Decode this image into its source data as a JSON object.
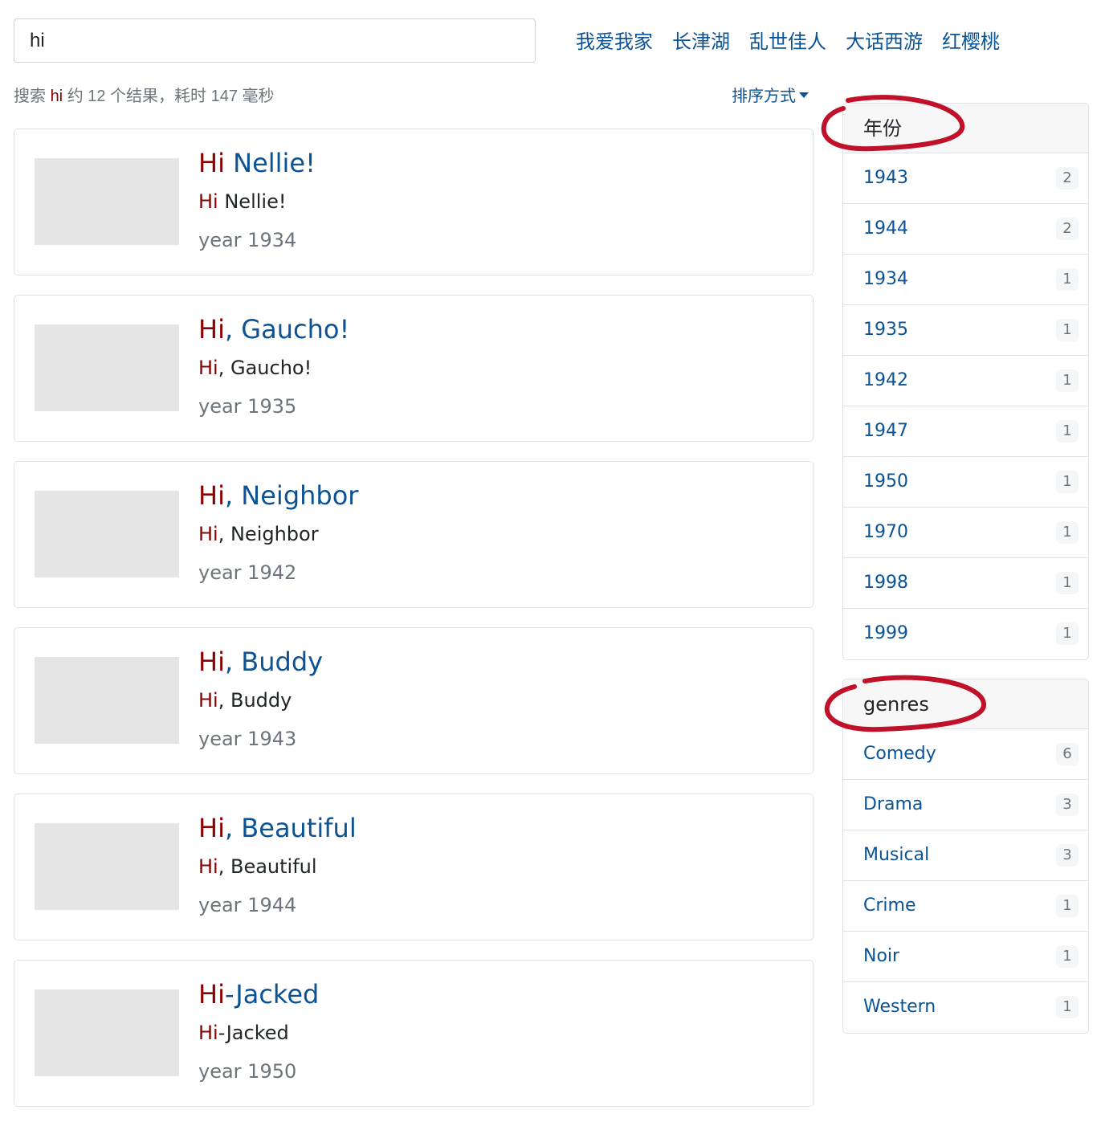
{
  "search": {
    "value": "hi",
    "placeholder": ""
  },
  "hot_links": [
    "我爱我家",
    "长津湖",
    "乱世佳人",
    "大话西游",
    "红樱桃"
  ],
  "summary": {
    "prefix": "搜索 ",
    "query": "hi",
    "suffix": " 约 12 个结果，耗时 147 毫秒"
  },
  "sort": {
    "label": "排序方式",
    "icon": "caret-down-icon"
  },
  "results": [
    {
      "title_hl": "Hi",
      "title_rest": " Nellie!",
      "sub_hl": "Hi",
      "sub_rest": " Nellie!",
      "year": "year 1934"
    },
    {
      "title_hl": "Hi",
      "title_rest": ", Gaucho!",
      "sub_hl": "Hi",
      "sub_rest": ", Gaucho!",
      "year": "year 1935"
    },
    {
      "title_hl": "Hi",
      "title_rest": ", Neighbor",
      "sub_hl": "Hi",
      "sub_rest": ", Neighbor",
      "year": "year 1942"
    },
    {
      "title_hl": "Hi",
      "title_rest": ", Buddy",
      "sub_hl": "Hi",
      "sub_rest": ", Buddy",
      "year": "year 1943"
    },
    {
      "title_hl": "Hi",
      "title_rest": ", Beautiful",
      "sub_hl": "Hi",
      "sub_rest": ", Beautiful",
      "year": "year 1944"
    },
    {
      "title_hl": "Hi",
      "title_rest": "-Jacked",
      "sub_hl": "Hi",
      "sub_rest": "-Jacked",
      "year": "year 1950"
    }
  ],
  "facets": {
    "year": {
      "title": "年份",
      "items": [
        {
          "label": "1943",
          "count": "2"
        },
        {
          "label": "1944",
          "count": "2"
        },
        {
          "label": "1934",
          "count": "1"
        },
        {
          "label": "1935",
          "count": "1"
        },
        {
          "label": "1942",
          "count": "1"
        },
        {
          "label": "1947",
          "count": "1"
        },
        {
          "label": "1950",
          "count": "1"
        },
        {
          "label": "1970",
          "count": "1"
        },
        {
          "label": "1998",
          "count": "1"
        },
        {
          "label": "1999",
          "count": "1"
        }
      ]
    },
    "genres": {
      "title": "genres",
      "items": [
        {
          "label": "Comedy",
          "count": "6"
        },
        {
          "label": "Drama",
          "count": "3"
        },
        {
          "label": "Musical",
          "count": "3"
        },
        {
          "label": "Crime",
          "count": "1"
        },
        {
          "label": "Noir",
          "count": "1"
        },
        {
          "label": "Western",
          "count": "1"
        }
      ]
    }
  },
  "colors": {
    "link": "#0b5394",
    "highlight": "#8b0000",
    "annotation": "#c0102a"
  }
}
